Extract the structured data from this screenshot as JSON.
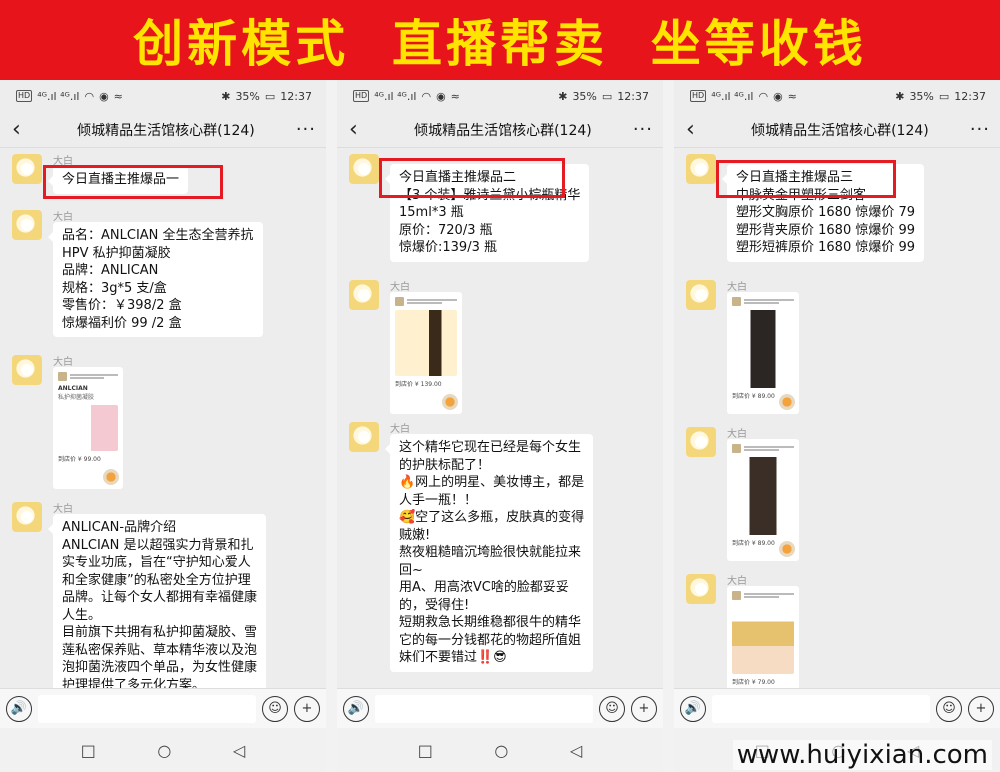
{
  "banner": {
    "text": "创新模式  直播帮卖  坐等收钱"
  },
  "status": {
    "battery": "35%",
    "time": "12:37",
    "hd": "HD",
    "signal": "⁴ᴳ.ıl ⁴ᴳ.ıl",
    "wifi": "◠",
    "eye": "◉",
    "nfc": "≈",
    "bt": "✱",
    "mute": "🔕",
    "batt_icon": "▭"
  },
  "chat": {
    "title": "倾城精品生活馆核心群(124)",
    "back_icon": "back-icon",
    "more_icon": "more-icon"
  },
  "sender": "大白",
  "phone1": {
    "m1": "今日直播主推爆品一",
    "m2": "品名：ANLCIAN 全生态全营养抗\nHPV 私护抑菌凝胶\n品牌：ANLICAN\n规格：3g*5 支/盒\n零售价：￥398/2 盒\n惊爆福利价 99 /2 盒",
    "card": {
      "brand": "ANLCIAN",
      "sub": "私护抑菌凝胶",
      "price": "到店价 ¥ 99.00"
    },
    "m4": "ANLICAN-品牌介绍\nANLCIAN 是以超强实力背景和扎\n实专业功底，旨在“守护知心爱人\n和全家健康”的私密处全方位护理\n品牌。让每个女人都拥有幸福健康\n人生。\n目前旗下共拥有私护抑菌凝胶、雪\n莲私密保养贴、草本精华液以及泡\n泡抑菌洗液四个单品，为女性健康\n护理提供了多元化方案。"
  },
  "phone2": {
    "m1": "今日直播主推爆品二\n【3 个装】雅诗兰黛小棕瓶精华\n15ml*3 瓶\n原价：720/3 瓶\n惊爆价:139/3 瓶",
    "card": {
      "price": "到店价 ¥ 139.00"
    },
    "m3": "这个精华它现在已经是每个女生\n的护肤标配了！\n🔥网上的明星、美妆博主，都是\n人手一瓶！！\n🥰空了这么多瓶，皮肤真的变得\n贼嫩!\n熬夜粗糙暗沉垮脸很快就能拉来\n回~\n用A、用高浓VC啥的脸都妥妥\n的，受得住!\n短期救急长期维稳都很牛的精华\n它的每一分钱都花的物超所值姐\n妹们不要错过‼️😎"
  },
  "phone3": {
    "m1": "今日直播主推爆品三\n中脉黄金甲塑形三剑客\n塑形文胸原价 1680 惊爆价 79\n塑形背夹原价 1680 惊爆价 99\n塑形短裤原价 1680 惊爆价 99",
    "card1": {
      "price": "到店价 ¥ 89.00"
    },
    "card2": {
      "price": "到店价 ¥ 89.00"
    },
    "card3": {
      "price": "到店价 ¥ 79.00"
    }
  },
  "inputbar": {
    "voice": "🔊",
    "emoji": "☺",
    "plus": "+"
  },
  "navsys": {
    "back": "◁",
    "home": "○",
    "recent": "□"
  },
  "watermark": "www.huiyixian.com",
  "colors": {
    "banner_bg": "#e8141c",
    "banner_text": "#ffe400",
    "highlight": "#e51b23"
  }
}
